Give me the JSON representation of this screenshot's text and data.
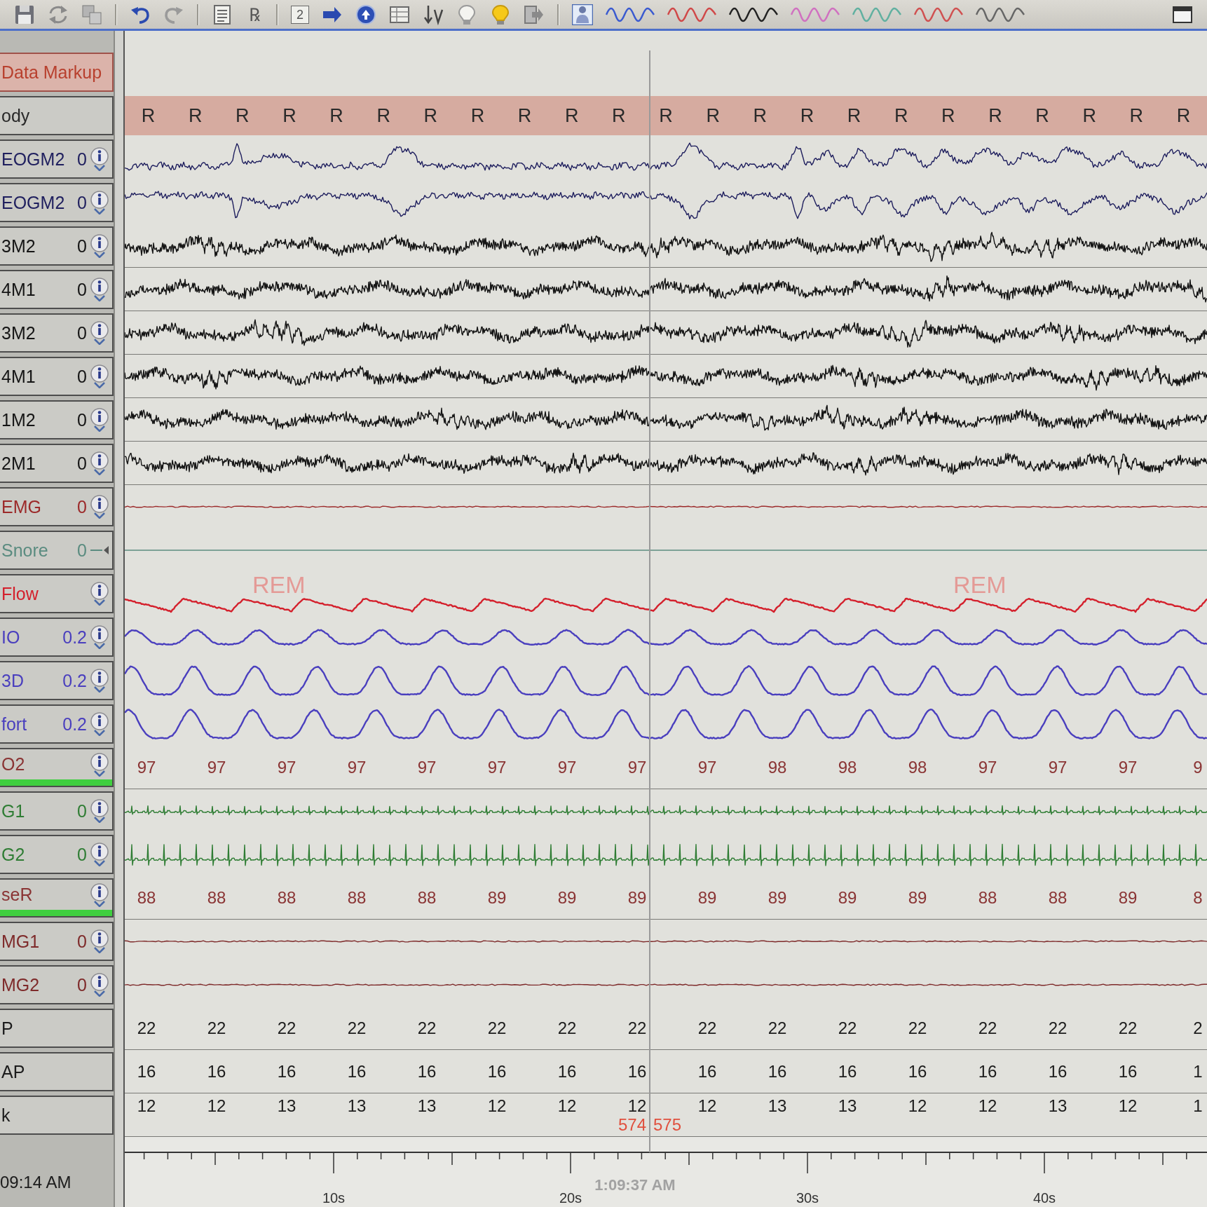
{
  "toolbar": [
    {
      "kind": "icon",
      "selected": false
    },
    {
      "kind": "icon",
      "selected": false
    },
    {
      "kind": "icon",
      "selected": false
    },
    {
      "kind": "separator"
    },
    {
      "kind": "icon",
      "selected": false
    },
    {
      "kind": "icon",
      "selected": false
    },
    {
      "kind": "separator"
    },
    {
      "kind": "icon",
      "selected": false
    },
    {
      "kind": "glyph",
      "text": "℞",
      "selected": false
    },
    {
      "kind": "separator"
    },
    {
      "kind": "glyph",
      "text": "2",
      "selected": false
    },
    {
      "kind": "icon",
      "selected": false
    },
    {
      "kind": "icon",
      "selected": false
    },
    {
      "kind": "icon",
      "selected": false
    },
    {
      "kind": "icon",
      "selected": false
    },
    {
      "kind": "icon",
      "selected": false
    },
    {
      "kind": "icon",
      "selected": false
    },
    {
      "kind": "icon",
      "selected": false
    },
    {
      "kind": "separator"
    },
    {
      "kind": "icon",
      "selected": true
    },
    {
      "kind": "trace",
      "color": "#3a5ad0",
      "selected": false
    },
    {
      "kind": "trace",
      "color": "#d04848",
      "selected": false
    },
    {
      "kind": "trace",
      "color": "#222222",
      "selected": false
    },
    {
      "kind": "trace",
      "color": "#d070c0",
      "selected": false
    },
    {
      "kind": "trace",
      "color": "#60b0a0",
      "selected": false
    },
    {
      "kind": "trace",
      "color": "#d05050",
      "selected": false
    },
    {
      "kind": "trace",
      "color": "#666666",
      "selected": false
    },
    {
      "kind": "icon",
      "selected": false
    }
  ],
  "channels": [
    {
      "kind": "markup",
      "label": "Data Markup",
      "color": "#b8402e",
      "info": false,
      "dash_marker": false,
      "quality_bar": false
    },
    {
      "kind": "annotation",
      "label": "ody",
      "color": "#2a2a2a",
      "info": false,
      "dash_marker": false,
      "quality_bar": false,
      "marks": [
        "R",
        "R",
        "R",
        "R",
        "R",
        "R",
        "R",
        "R",
        "R",
        "R",
        "R",
        "R",
        "R",
        "R",
        "R",
        "R",
        "R",
        "R",
        "R",
        "R",
        "R",
        "R",
        "R"
      ]
    },
    {
      "kind": "eog",
      "label": "EOGM2",
      "value": "0",
      "color": "#1f1f5e",
      "info": true,
      "dash_marker": false,
      "quality_bar": false
    },
    {
      "kind": "eog",
      "label": "EOGM2",
      "value": "0",
      "color": "#1f1f5e",
      "info": true,
      "dash_marker": false,
      "quality_bar": false
    },
    {
      "kind": "eeg",
      "label": "3M2",
      "value": "0",
      "color": "#151515",
      "info": true,
      "dash_marker": false,
      "quality_bar": false
    },
    {
      "kind": "eeg",
      "label": "4M1",
      "value": "0",
      "color": "#151515",
      "info": true,
      "dash_marker": false,
      "quality_bar": false
    },
    {
      "kind": "eeg",
      "label": "3M2",
      "value": "0",
      "color": "#151515",
      "info": true,
      "dash_marker": false,
      "quality_bar": false
    },
    {
      "kind": "eeg",
      "label": "4M1",
      "value": "0",
      "color": "#151515",
      "info": true,
      "dash_marker": false,
      "quality_bar": false
    },
    {
      "kind": "eeg",
      "label": "1M2",
      "value": "0",
      "color": "#151515",
      "info": true,
      "dash_marker": false,
      "quality_bar": false
    },
    {
      "kind": "eeg",
      "label": "2M1",
      "value": "0",
      "color": "#151515",
      "info": true,
      "dash_marker": false,
      "quality_bar": false
    },
    {
      "kind": "flat",
      "label": "EMG",
      "value": "0",
      "color": "#9c2a2a",
      "info": true,
      "dash_marker": false,
      "quality_bar": false
    },
    {
      "kind": "baseline",
      "label": "Snore",
      "value": "0",
      "color": "#5b8c80",
      "info": false,
      "dash_marker": true,
      "quality_bar": false
    },
    {
      "kind": "flow",
      "label": "Flow",
      "color": "#d4202c",
      "info": true,
      "dash_marker": false,
      "quality_bar": false,
      "overlays": [
        "REM",
        "REM"
      ]
    },
    {
      "kind": "effort",
      "label": "IO",
      "value": "0.2",
      "color": "#4a3fbe",
      "info": true,
      "dash_marker": false,
      "quality_bar": false
    },
    {
      "kind": "effort",
      "label": "3D",
      "value": "0.2",
      "color": "#4a3fbe",
      "info": true,
      "dash_marker": false,
      "quality_bar": false
    },
    {
      "kind": "effort",
      "label": "fort",
      "value": "0.2",
      "color": "#4a3fbe",
      "info": true,
      "dash_marker": false,
      "quality_bar": false
    },
    {
      "kind": "numeric",
      "label": "O2",
      "color": "#8a3434",
      "info": true,
      "dash_marker": false,
      "quality_bar": true,
      "readings": [
        "97",
        "97",
        "97",
        "97",
        "97",
        "97",
        "97",
        "97",
        "97",
        "98",
        "98",
        "98",
        "97",
        "97",
        "97",
        "9"
      ]
    },
    {
      "kind": "ecg",
      "label": "G1",
      "value": "0",
      "color": "#2f7d34",
      "info": true,
      "dash_marker": false,
      "quality_bar": false
    },
    {
      "kind": "spike",
      "label": "G2",
      "value": "0",
      "color": "#2f7d34",
      "info": true,
      "dash_marker": false,
      "quality_bar": false
    },
    {
      "kind": "numeric",
      "label": "seR",
      "color": "#8a3434",
      "info": true,
      "dash_marker": false,
      "quality_bar": true,
      "readings": [
        "88",
        "88",
        "88",
        "88",
        "88",
        "89",
        "89",
        "89",
        "89",
        "89",
        "89",
        "89",
        "88",
        "88",
        "89",
        "8"
      ]
    },
    {
      "kind": "flat",
      "label": "MG1",
      "value": "0",
      "color": "#7e2a2a",
      "info": true,
      "dash_marker": false,
      "quality_bar": false
    },
    {
      "kind": "flat",
      "label": "MG2",
      "value": "0",
      "color": "#7e2a2a",
      "info": true,
      "dash_marker": false,
      "quality_bar": false
    },
    {
      "kind": "numeric",
      "label": "P",
      "color": "#1c1c1c",
      "info": false,
      "dash_marker": false,
      "quality_bar": false,
      "readings": [
        "22",
        "22",
        "22",
        "22",
        "22",
        "22",
        "22",
        "22",
        "22",
        "22",
        "22",
        "22",
        "22",
        "22",
        "22",
        "2"
      ]
    },
    {
      "kind": "numeric",
      "label": "AP",
      "color": "#1c1c1c",
      "info": false,
      "dash_marker": false,
      "quality_bar": false,
      "readings": [
        "16",
        "16",
        "16",
        "16",
        "16",
        "16",
        "16",
        "16",
        "16",
        "16",
        "16",
        "16",
        "16",
        "16",
        "16",
        "1"
      ]
    },
    {
      "kind": "numeric",
      "label": "k",
      "color": "#1c1c1c",
      "info": false,
      "dash_marker": false,
      "quality_bar": false,
      "readings": [
        "12",
        "12",
        "13",
        "13",
        "13",
        "12",
        "12",
        "12",
        "12",
        "13",
        "13",
        "12",
        "12",
        "13",
        "12",
        "1"
      ],
      "epochs": [
        "574",
        "575"
      ]
    }
  ],
  "time_axis": {
    "start_time": "09:14 AM",
    "cursor_time": "1:09:37 AM",
    "ticks": [
      "10s",
      "20s",
      "30s",
      "40s"
    ]
  }
}
